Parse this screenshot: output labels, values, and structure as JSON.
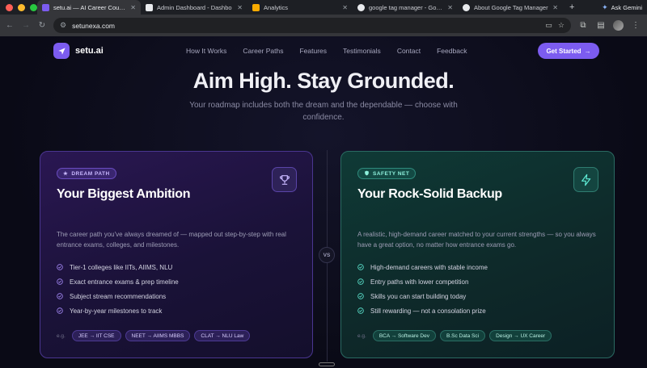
{
  "browser": {
    "tabs": [
      {
        "label": "setu.ai — AI Career Counsel",
        "active": true,
        "favicon_color": "#7c5cf0"
      },
      {
        "label": "Admin Dashboard - Dashbo",
        "active": false,
        "favicon_color": "#e8eaed"
      },
      {
        "label": "Analytics",
        "active": false,
        "favicon_color": "#f9ab00"
      },
      {
        "label": "google tag manager - Googl",
        "active": false,
        "favicon_color": "#e8eaed"
      },
      {
        "label": "About Google Tag Manager",
        "active": false,
        "favicon_color": "#e8eaed"
      }
    ],
    "new_tab_glyph": "+",
    "gemini_label": "Ask Gemini",
    "url": "setunexa.com"
  },
  "nav": {
    "logo_text": "setu.ai",
    "links": [
      "How It Works",
      "Career Paths",
      "Features",
      "Testimonials",
      "Contact",
      "Feedback"
    ],
    "cta_label": "Get Started",
    "cta_arrow": "→"
  },
  "hero": {
    "headline": "Aim High. Stay Grounded.",
    "subline": "Your roadmap includes both the dream and the dependable — choose with confidence."
  },
  "vs_label": "VS",
  "dream": {
    "badge": "DREAM PATH",
    "title": "Your Biggest Ambition",
    "description": "The career path you've always dreamed of — mapped out step-by-step with real entrance exams, colleges, and milestones.",
    "features": [
      "Tier-1 colleges like IITs, AIIMS, NLU",
      "Exact entrance exams & prep timeline",
      "Subject stream recommendations",
      "Year-by-year milestones to track"
    ],
    "eg_label": "e.g.",
    "examples": [
      "JEE → IIT CSE",
      "NEET → AIIMS MBBS",
      "CLAT → NLU Law"
    ],
    "accent": "#a78bfa",
    "icon": "trophy-icon"
  },
  "safety": {
    "badge": "SAFETY NET",
    "title": "Your Rock-Solid Backup",
    "description": "A realistic, high-demand career matched to your current strengths — so you always have a great option, no matter how entrance exams go.",
    "features": [
      "High-demand careers with stable income",
      "Entry paths with lower competition",
      "Skills you can start building today",
      "Still rewarding — not a consolation prize"
    ],
    "eg_label": "e.g.",
    "examples": [
      "BCA → Software Dev",
      "B.Sc Data Sci",
      "Design → UX Career"
    ],
    "accent": "#5eead4",
    "icon": "lightning-icon"
  }
}
